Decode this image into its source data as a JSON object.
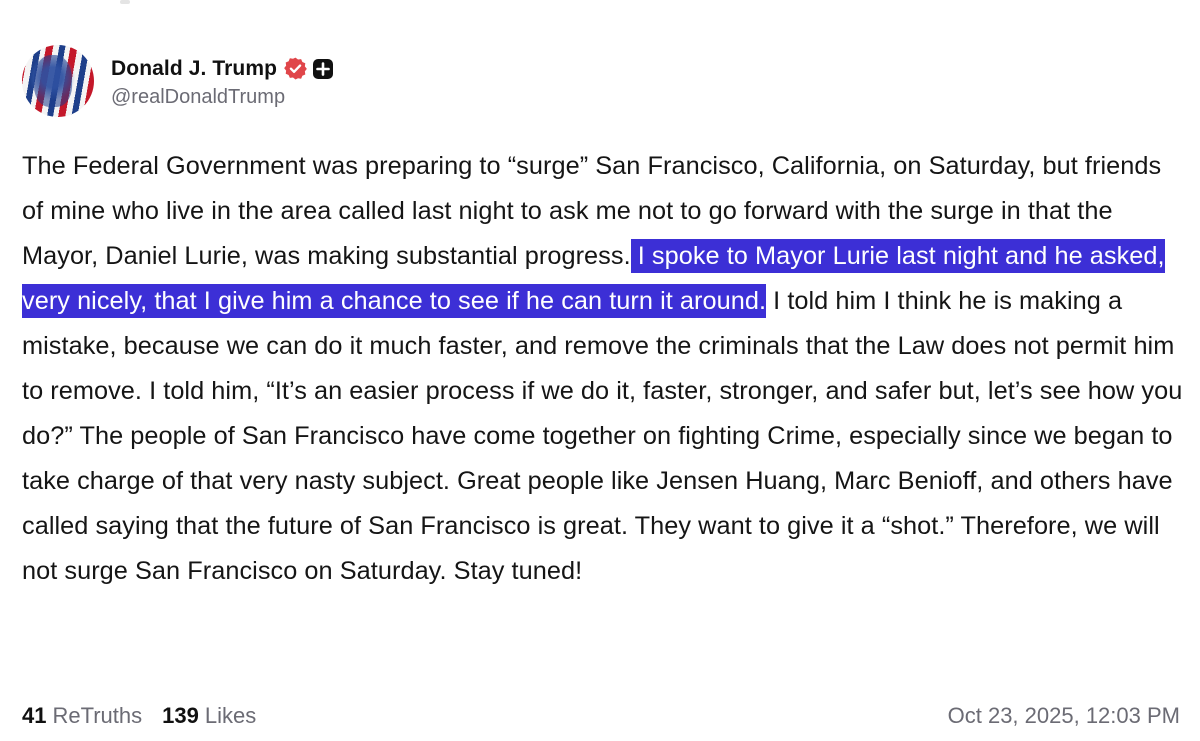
{
  "author": {
    "display_name": "Donald J. Trump",
    "handle": "@realDonaldTrump"
  },
  "post": {
    "text_before": "The Federal Government was preparing to “surge” San Francisco, California, on Saturday, but friends of mine who live in the area called last night to ask me not to go forward with the surge in that the Mayor, Daniel Lurie, was making substantial progress.",
    "text_highlighted": " I spoke to Mayor Lurie last night and he asked, very nicely, that I give him a chance to see if he can turn it around.",
    "text_after": " I told him I think he is making a mistake, because we can do it much faster, and remove the criminals that the Law does not permit him to remove. I told him, “It’s an easier process if we do it, faster, stronger, and safer but, let’s see how you do?” The people of San Francisco have come together on fighting Crime, especially since we began to take charge of that very nasty subject. Great people like Jensen Huang, Marc Benioff, and others have called saying that the future of San Francisco is great. They want to give it a “shot.” Therefore, we will not surge San Francisco on Saturday. Stay tuned!",
    "highlight_color": "#3c2fd6"
  },
  "stats": {
    "retruths_count": "41",
    "retruths_label": "ReTruths",
    "likes_count": "139",
    "likes_label": "Likes"
  },
  "timestamp": "Oct 23, 2025, 12:03 PM",
  "icons": {
    "verified": "verified-badge-icon",
    "plus": "plus-badge-icon"
  },
  "colors": {
    "verified_badge": "#e0464a",
    "muted_text": "#6b6b74"
  }
}
